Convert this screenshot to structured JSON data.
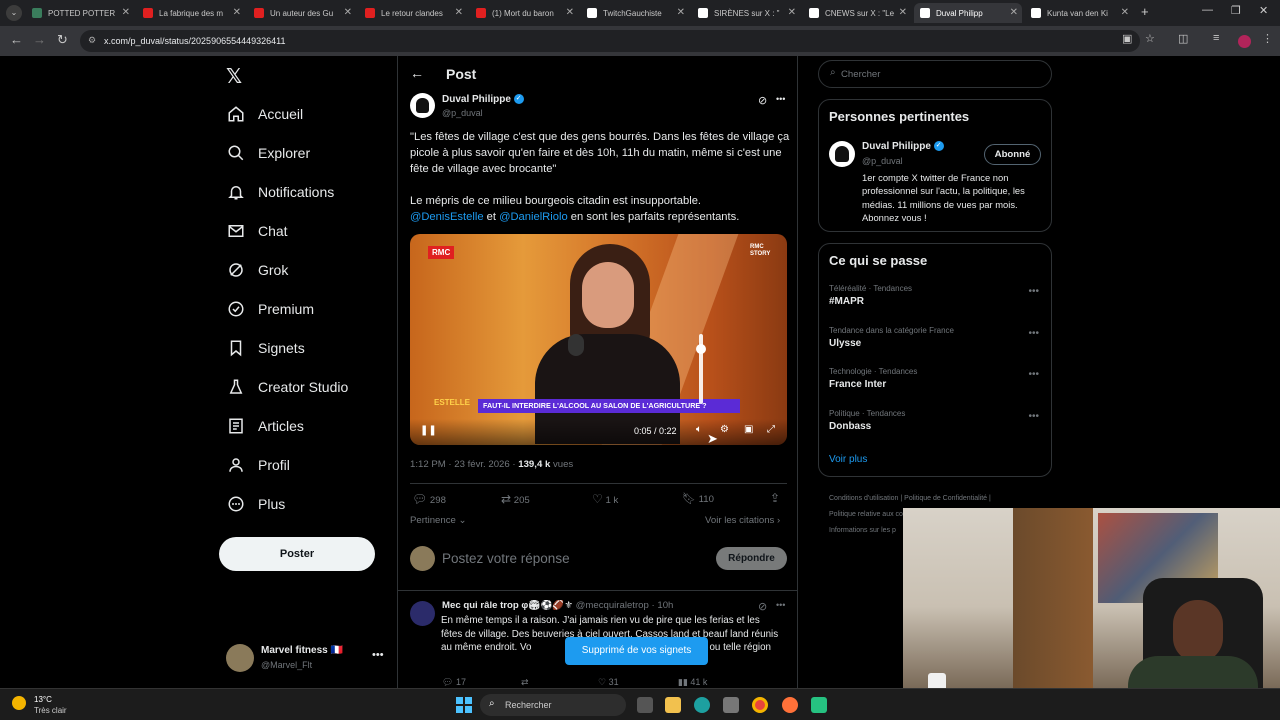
{
  "browser": {
    "tabs": [
      {
        "title": "POTTED POTTER ",
        "color": "#3a7d5c"
      },
      {
        "title": "La fabrique des m",
        "color": "#e02020"
      },
      {
        "title": "Un auteur des Gu",
        "color": "#e02020"
      },
      {
        "title": "Le retour clandes",
        "color": "#e02020"
      },
      {
        "title": "(1) Mort du baron",
        "color": "#e02020"
      },
      {
        "title": "TwitchGauchiste",
        "color": "#ffffff"
      },
      {
        "title": "SIRÈNES sur X : \"",
        "color": "#ffffff"
      },
      {
        "title": "CNEWS sur X : \"Le",
        "color": "#ffffff"
      },
      {
        "title": "Duval Philipp",
        "color": "#ffffff"
      },
      {
        "title": "Kunta van den Ki",
        "color": "#ffffff"
      }
    ],
    "url": "x.com/p_duval/status/2025906554449326411"
  },
  "nav": {
    "items": [
      {
        "label": "Accueil",
        "icon": "home-icon"
      },
      {
        "label": "Explorer",
        "icon": "search-icon"
      },
      {
        "label": "Notifications",
        "icon": "bell-icon"
      },
      {
        "label": "Chat",
        "icon": "mail-icon"
      },
      {
        "label": "Grok",
        "icon": "grok-icon"
      },
      {
        "label": "Premium",
        "icon": "premium-icon"
      },
      {
        "label": "Signets",
        "icon": "bookmark-icon"
      },
      {
        "label": "Creator Studio",
        "icon": "flask-icon"
      },
      {
        "label": "Articles",
        "icon": "article-icon"
      },
      {
        "label": "Profil",
        "icon": "profile-icon"
      },
      {
        "label": "Plus",
        "icon": "more-icon"
      }
    ],
    "post_button": "Poster",
    "account": {
      "name": "Marvel fitness 🇫🇷",
      "handle": "@Marvel_Flt"
    }
  },
  "post": {
    "header_title": "Post",
    "author_name": "Duval Philippe",
    "author_handle": "@p_duval",
    "text_quote": "\"Les fêtes de village c'est que des gens bourrés. Dans les fêtes de village ça picole à plus savoir qu'en faire et dès 10h, 11h du matin, même si c'est une fête de village avec brocante\"",
    "text_line2": "Le mépris de ce milieu bourgeois citadin est insupportable.",
    "mention1": "@DenisEstelle",
    "and_word": "et",
    "mention2": "@DanielRiolo",
    "text_end": "en sont les parfaits représentants.",
    "video": {
      "channel_logo": "RMC",
      "corner_logo": "RMC STORY",
      "show_logo": "ESTELLE",
      "banner": "FAUT-IL INTERDIRE L'ALCOOL AU SALON DE L'AGRICULTURE ?",
      "time": "0:05 / 0:22"
    },
    "meta_time": "1:12 PM · 23 févr. 2026 · ",
    "views_count": "139,4 k",
    "views_label": " vues",
    "stats": {
      "replies": "298",
      "reposts": "205",
      "likes": "1 k",
      "bookmarks": "110"
    },
    "sort_label": "Pertinence",
    "quotes_link": "Voir les citations",
    "reply_placeholder": "Postez votre réponse",
    "reply_button": "Répondre"
  },
  "reply": {
    "name": "Mec qui râle trop φ🏟⚽🏈⚜",
    "handle": "@mecquiraletrop",
    "time": "10h",
    "text": "En même temps il a raison. J'ai jamais rien vu de pire que les ferias et les fêtes de village. Des beuveries à ciel ouvert. Cassos land et beauf land réunis au même endroit. Vo",
    "text_tail": "telle ou telle région",
    "stats": {
      "replies": "17",
      "likes": "31",
      "views": "41 k"
    }
  },
  "toast": "Supprimé de vos signets",
  "sidebar": {
    "search_placeholder": "Chercher",
    "relevant_title": "Personnes pertinentes",
    "person": {
      "name": "Duval Philippe",
      "handle": "@p_duval",
      "button": "Abonné",
      "bio": "1er compte X twitter de France non professionnel sur l'actu, la politique, les médias. 11 millions de vues par mois. Abonnez vous !"
    },
    "trending_title": "Ce qui se passe",
    "trends": [
      {
        "category": "Téléréalité · Tendances",
        "name": "#MAPR"
      },
      {
        "category": "Tendance dans la catégorie France",
        "name": "Ulysse"
      },
      {
        "category": "Technologie · Tendances",
        "name": "France Inter"
      },
      {
        "category": "Politique · Tendances",
        "name": "Donbass"
      }
    ],
    "show_more": "Voir plus",
    "footer_line1a": "Conditions d'utilisation",
    "footer_line1b": "Politique de Confidentialité",
    "footer_line2": "Politique relative aux co",
    "footer_line3": "Informations sur les p"
  },
  "taskbar": {
    "weather_temp": "13°C",
    "weather_desc": "Très clair",
    "search": "Rechercher"
  },
  "colors": {
    "accent": "#1d9bf0",
    "verified": "#1d9bf0",
    "banner": "#5b2bd6"
  }
}
